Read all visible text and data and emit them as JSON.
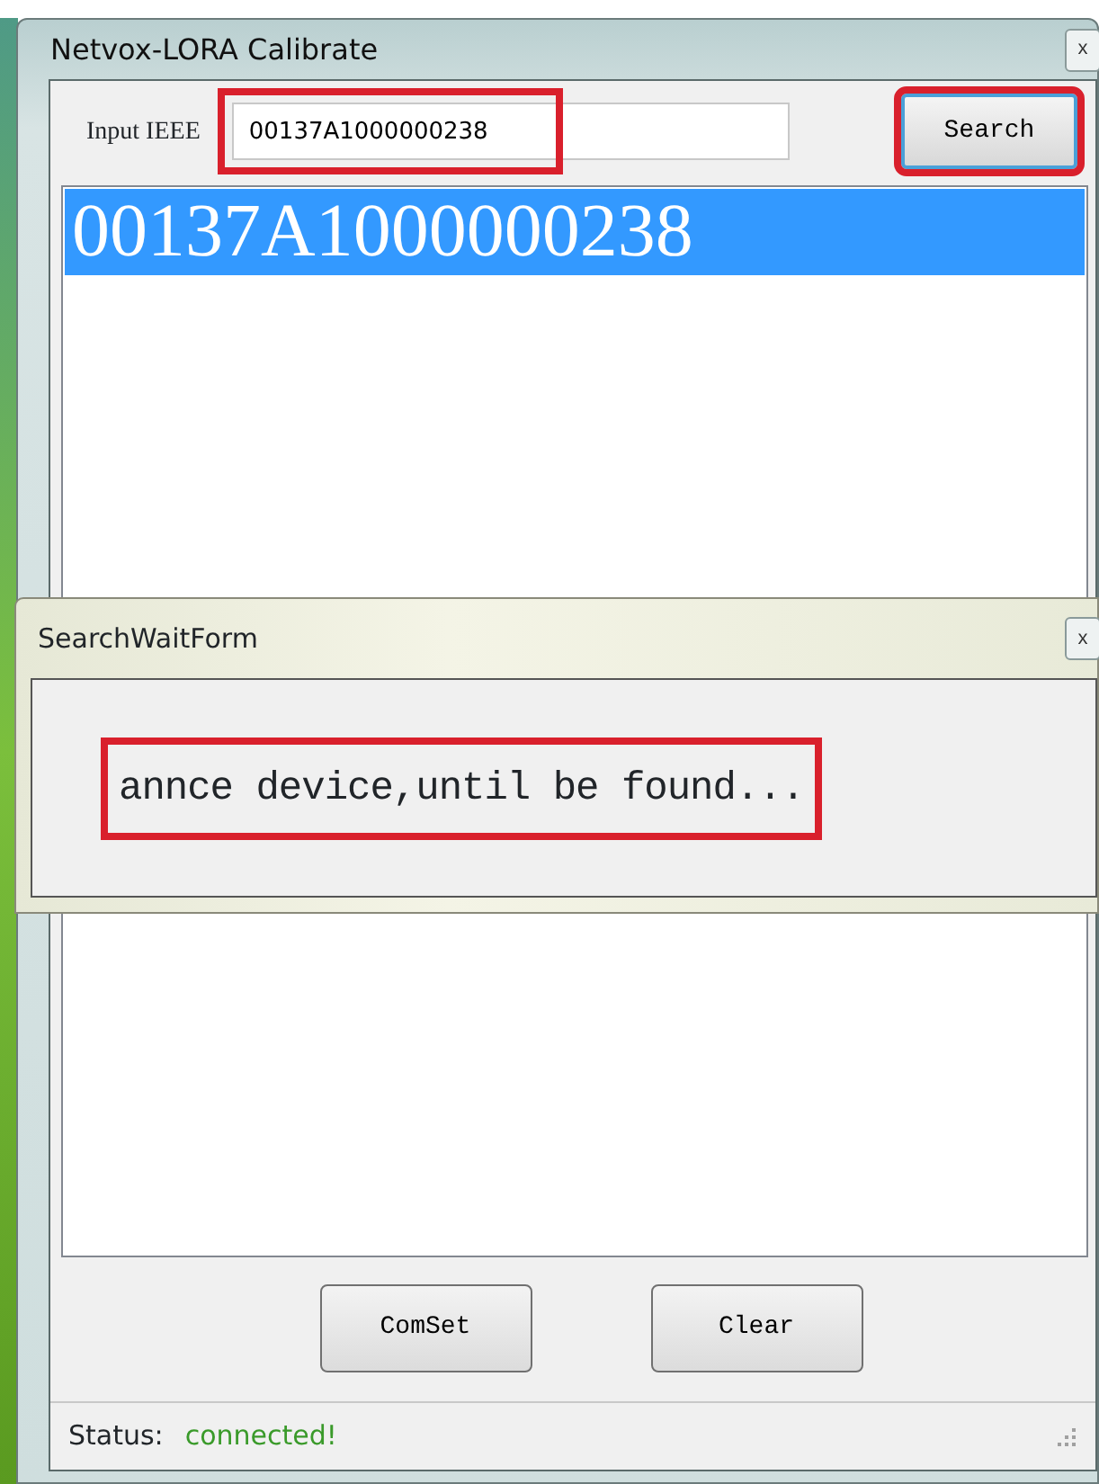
{
  "window": {
    "title": "Netvox-LORA Calibrate",
    "close": "x"
  },
  "input": {
    "label": "Input IEEE",
    "value": "00137A1000000238",
    "highlighted": true
  },
  "search_button": {
    "label": "Search",
    "highlighted": true
  },
  "list": {
    "items": [
      {
        "text": "00137A1000000238",
        "selected": true
      }
    ]
  },
  "dialog": {
    "title": "SearchWaitForm",
    "close": "x",
    "message": "annce device,until be found...",
    "highlighted": true
  },
  "buttons": [
    "ComSet",
    "Clear"
  ],
  "status_bar": {
    "label": "Status:",
    "value": "connected!"
  }
}
